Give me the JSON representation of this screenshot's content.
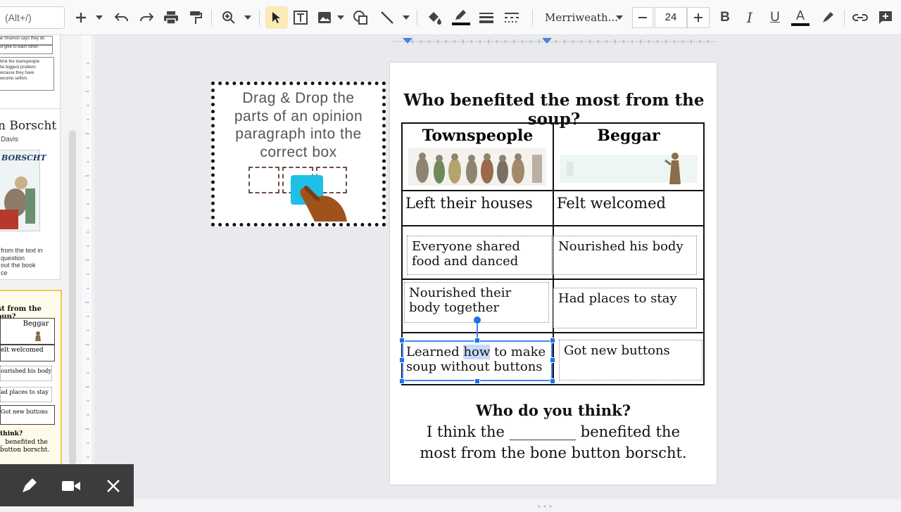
{
  "toolbar": {
    "search_placeholder": "(Alt+/)",
    "font_name": "Merriweath...",
    "font_size": "24"
  },
  "filmstrip": {
    "thumb1_lines": [
      "the Shamos says they do",
      "not give to each other.",
      "",
      "think the townspeople",
      "the biggest problem",
      "because they have",
      "become selfish."
    ],
    "thumb2_title": "n Borscht",
    "thumb2_author": "Davis",
    "thumb2_cover_text": "BORSCHT",
    "thumb2_lines": [
      "from the text in",
      "question",
      "out the book",
      "ce"
    ],
    "thumb3_title": "ost from the soup?",
    "thumb3_col": "Beggar",
    "thumb3_rows": [
      "elt welcomed",
      "ourished his body",
      "ad places to stay",
      "Got new buttons"
    ],
    "thumb3_q": "think?",
    "thumb3_lines": [
      "_ benefited the",
      "button borscht."
    ]
  },
  "instruction": {
    "text_lines": [
      "Drag & Drop the",
      "parts of an opinion",
      "paragraph into the",
      "correct  box"
    ]
  },
  "slide": {
    "title": "Who benefited the most from the soup?",
    "col1": "Townspeople",
    "col2": "Beggar",
    "row1_left": "Left their houses",
    "row1_right": "Felt welcomed",
    "card_left_1": "Everyone shared food and danced",
    "card_right_1": "Nourished his body",
    "card_left_2": "Nourished their body together",
    "card_right_2": "Had places to stay",
    "card_left_3_a": "Learned ",
    "card_left_3_hl": "how",
    "card_left_3_b": " to make soup without buttons",
    "card_right_3": "Got new buttons",
    "prompt_q": "Who do you think?",
    "prompt_line1": "I think the _________ benefited the",
    "prompt_line2": "most from the bone button borscht."
  },
  "colors": {
    "accent": "#1a73e8",
    "instruction_text": "#555555",
    "drag_square": "#1ec0e8",
    "hand": "#a0521b",
    "overlay": "#3c3c3c"
  }
}
